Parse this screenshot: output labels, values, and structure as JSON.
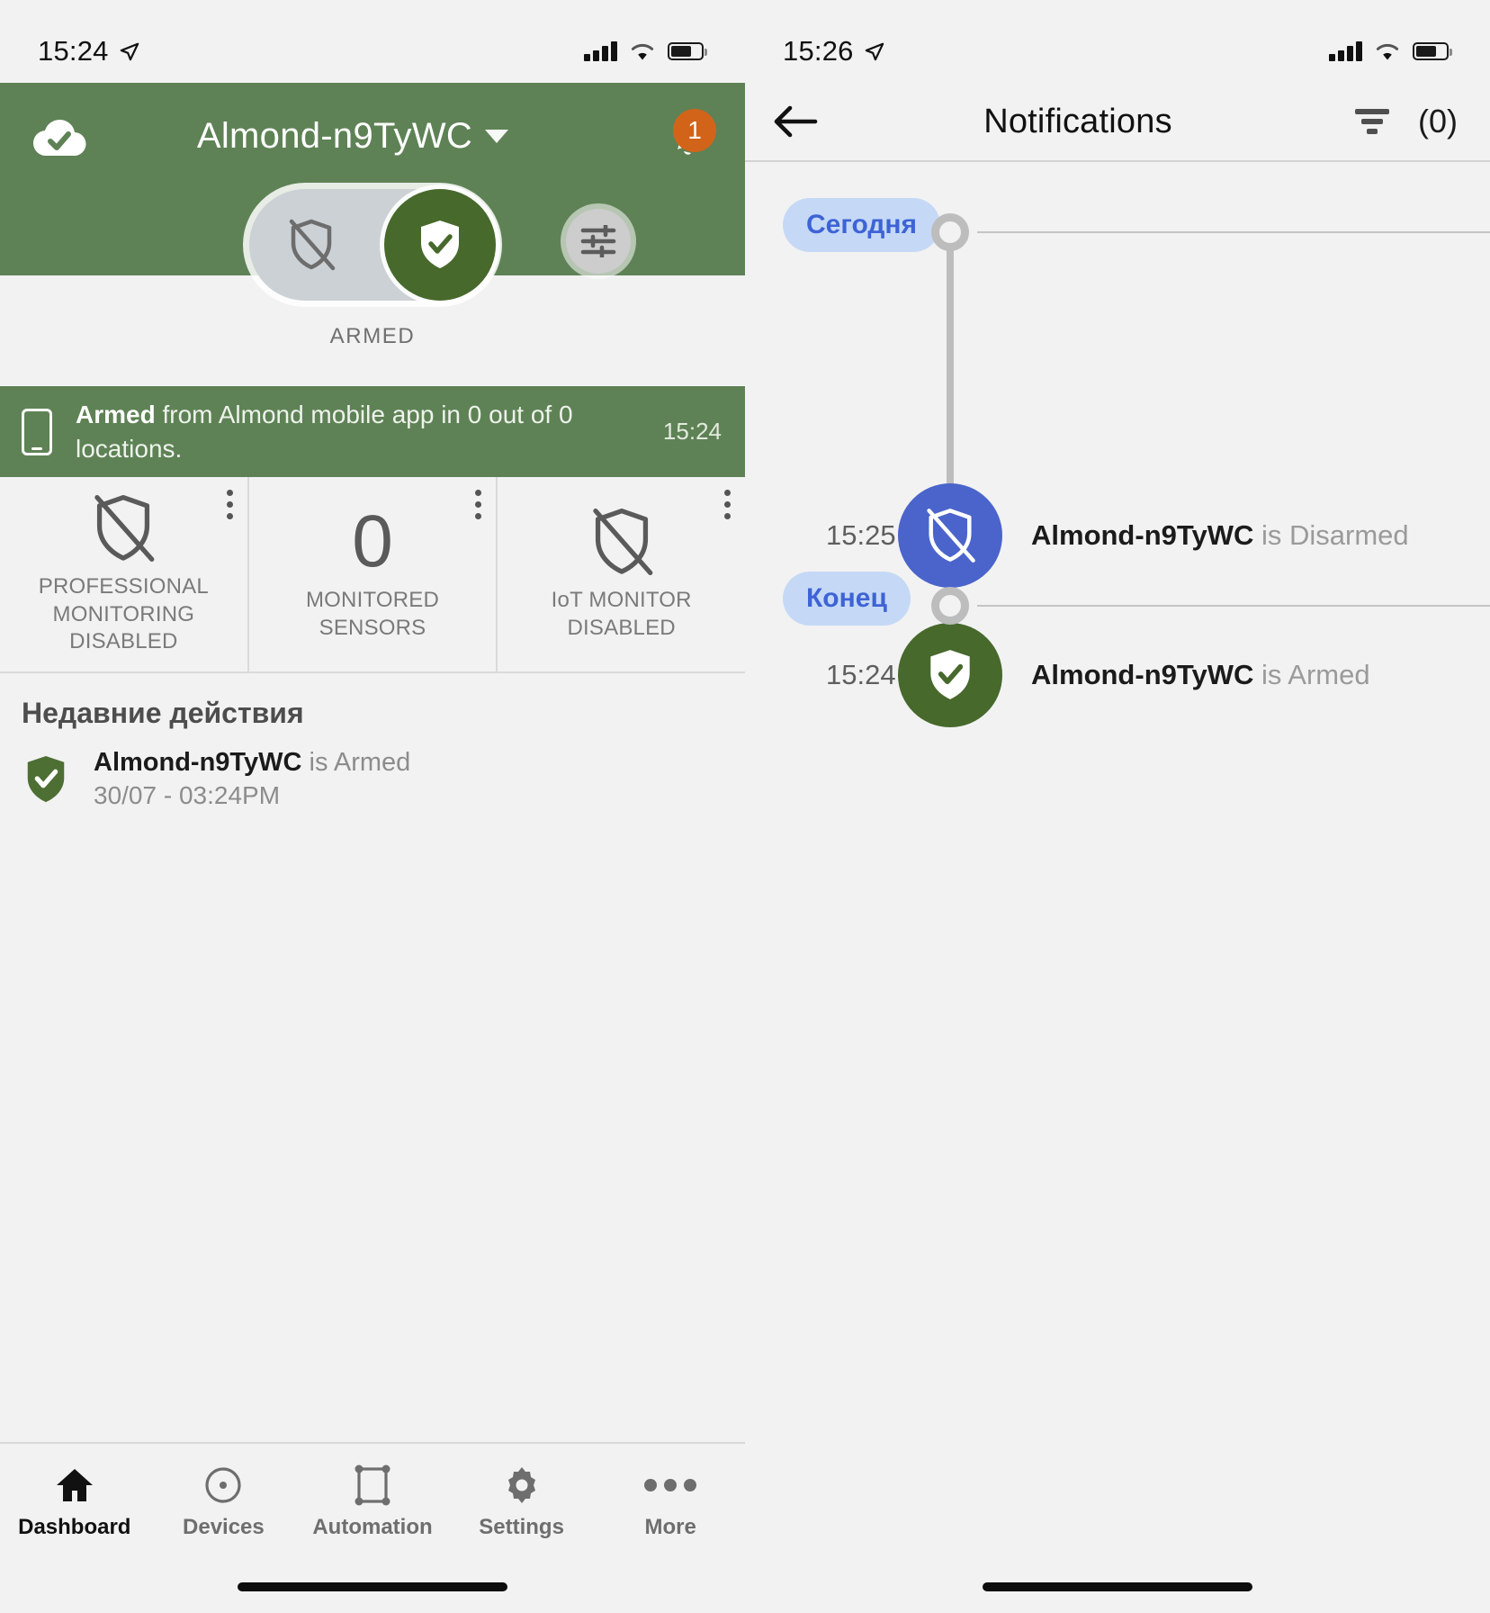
{
  "left_screen": {
    "status_bar": {
      "time": "15:24",
      "location_icon": "location-arrow-icon",
      "signal_icon": "cellular-signal-icon",
      "wifi_icon": "wifi-icon",
      "battery_icon": "battery-icon"
    },
    "header": {
      "cloud_icon": "cloud-check-icon",
      "title": "Almond-n9TyWC",
      "caret_icon": "chevron-down-icon",
      "bell_icon": "bell-icon",
      "bell_badge": "1",
      "bg_color": "#5e8255"
    },
    "toggle": {
      "disarm_icon": "shield-off-icon",
      "arm_icon": "shield-check-icon",
      "state_label": "ARMED",
      "active_color": "#47692c",
      "track_color": "#ccd1d5",
      "prefs_icon": "sliders-icon"
    },
    "message_bar": {
      "device_icon": "mobile-phone-icon",
      "bold_text": "Armed",
      "rest_text": " from Almond mobile app in 0 out of 0 locations.",
      "time": "15:24",
      "bg_color": "#5e8255"
    },
    "cards": [
      {
        "icon": "shield-off-icon",
        "value": "",
        "label": "PROFESSIONAL MONITORING DISABLED",
        "menu_icon": "kebab-menu-icon"
      },
      {
        "icon": "number",
        "value": "0",
        "label": "MONITORED SENSORS",
        "menu_icon": "kebab-menu-icon"
      },
      {
        "icon": "shield-off-icon",
        "value": "",
        "label": "IoT MONITOR DISABLED",
        "menu_icon": "kebab-menu-icon"
      }
    ],
    "recent": {
      "title": "Недавние действия",
      "items": [
        {
          "icon": "shield-check-icon",
          "device": "Almond-n9TyWC",
          "state": " is Armed",
          "timestamp": "30/07 - 03:24PM"
        }
      ]
    },
    "tabbar": [
      {
        "icon": "home-icon",
        "label": "Dashboard",
        "active": true
      },
      {
        "icon": "devices-icon",
        "label": "Devices",
        "active": false
      },
      {
        "icon": "automation-icon",
        "label": "Automation",
        "active": false
      },
      {
        "icon": "gear-icon",
        "label": "Settings",
        "active": false
      },
      {
        "icon": "ellipsis-icon",
        "label": "More",
        "active": false
      }
    ]
  },
  "right_screen": {
    "status_bar": {
      "time": "15:26",
      "location_icon": "location-arrow-icon"
    },
    "header": {
      "back_icon": "back-arrow-icon",
      "title": "Notifications",
      "filter_icon": "filter-icon",
      "count": "(0)"
    },
    "timeline": {
      "start_chip": "Сегодня",
      "end_chip": "Конец",
      "events": [
        {
          "time": "15:25",
          "icon": "shield-off-icon",
          "device": "Almond-n9TyWC",
          "state": " is Disarmed",
          "color": "#4b64cb"
        },
        {
          "time": "15:24",
          "icon": "shield-check-icon",
          "device": "Almond-n9TyWC",
          "state": " is Armed",
          "color": "#47692c"
        }
      ]
    }
  }
}
